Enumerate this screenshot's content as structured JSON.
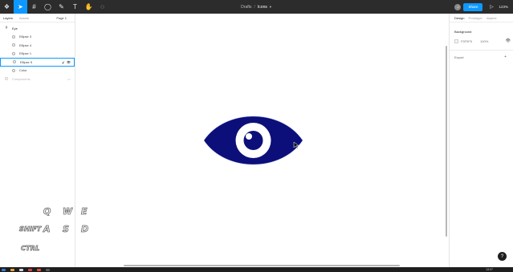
{
  "toolbar": {
    "breadcrumb_team": "Drafts",
    "breadcrumb_separator": "/",
    "file_name": "Icons",
    "avatar_initial": "J",
    "share_label": "Share",
    "zoom_level": "123%"
  },
  "left_panel": {
    "tabs": [
      "Layers",
      "Assets"
    ],
    "page_label": "Page 1",
    "frame_name": "Eye",
    "layers": [
      "Ellipse 3",
      "Ellipse 4",
      "Ellipse 1",
      "Ellipse 5",
      "Color"
    ],
    "components_label": "Components"
  },
  "right_panel": {
    "tabs": [
      "Design",
      "Prototype",
      "Inspect"
    ],
    "background_title": "Background",
    "background_hex": "F5F5F5",
    "background_opacity": "100%",
    "export_label": "Export"
  },
  "keyboard_overlay": {
    "q": "Q",
    "w": "W",
    "e": "E",
    "shift": "SHIFT",
    "a": "A",
    "s": "S",
    "d": "D",
    "ctrl": "CTRL"
  },
  "taskbar": {
    "clock": "13:07"
  },
  "colors": {
    "toolbar_bg": "#2c2c2c",
    "accent": "#0d99ff",
    "eye_outer": "#0c0f79",
    "eye_white": "#ffffff",
    "canvas_bg": "#ffffff"
  }
}
